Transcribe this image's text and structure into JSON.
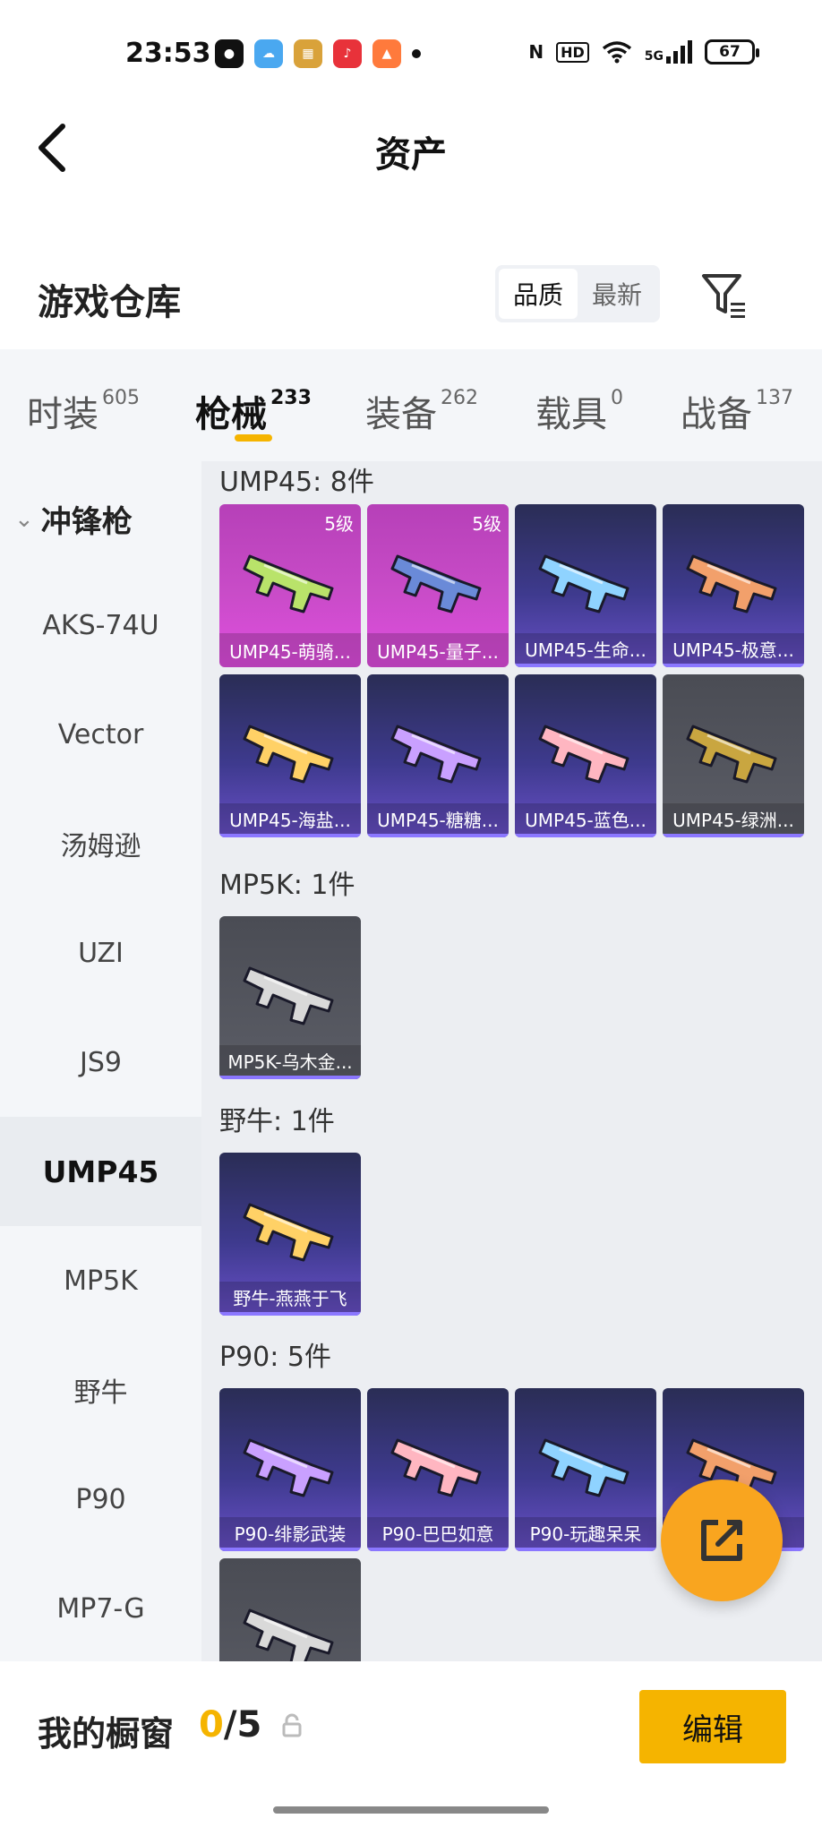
{
  "status": {
    "time": "23:53",
    "battery": "67",
    "network": "5G"
  },
  "header": {
    "title": "资产"
  },
  "warehouse": {
    "title": "游戏仓库",
    "sort_options": [
      "品质",
      "最新"
    ]
  },
  "tabs": [
    {
      "label": "时装",
      "count": "605"
    },
    {
      "label": "枪械",
      "count": "233"
    },
    {
      "label": "装备",
      "count": "262"
    },
    {
      "label": "载具",
      "count": "0"
    },
    {
      "label": "战备",
      "count": "137"
    }
  ],
  "sidebar": {
    "category": "冲锋枪",
    "items": [
      "AKS-74U",
      "Vector",
      "汤姆逊",
      "UZI",
      "JS9",
      "UMP45",
      "MP5K",
      "野牛",
      "P90",
      "MP7-G"
    ]
  },
  "sections": [
    {
      "title": "UMP45: 8件",
      "items": [
        {
          "label": "UMP45-萌骑...",
          "level": "5级",
          "style": "pink"
        },
        {
          "label": "UMP45-量子...",
          "level": "5级",
          "style": "pink"
        },
        {
          "label": "UMP45-生命...",
          "level": "",
          "style": "purple"
        },
        {
          "label": "UMP45-极意...",
          "level": "",
          "style": "purple"
        },
        {
          "label": "UMP45-海盐...",
          "level": "",
          "style": "purple"
        },
        {
          "label": "UMP45-糖糖...",
          "level": "",
          "style": "purple"
        },
        {
          "label": "UMP45-蓝色...",
          "level": "",
          "style": "purple"
        },
        {
          "label": "UMP45-绿洲...",
          "level": "",
          "style": "gray"
        }
      ]
    },
    {
      "title": "MP5K: 1件",
      "items": [
        {
          "label": "MP5K-乌木金...",
          "level": "",
          "style": "gray"
        }
      ]
    },
    {
      "title": "野牛: 1件",
      "items": [
        {
          "label": "野牛-燕燕于飞",
          "level": "",
          "style": "purple"
        }
      ]
    },
    {
      "title": "P90: 5件",
      "items": [
        {
          "label": "P90-绯影武装",
          "level": "",
          "style": "purple"
        },
        {
          "label": "P90-巴巴如意",
          "level": "",
          "style": "purple"
        },
        {
          "label": "P90-玩趣呆呆",
          "level": "",
          "style": "purple"
        },
        {
          "label": "影",
          "level": "",
          "style": "purple"
        },
        {
          "label": "",
          "level": "",
          "style": "gray"
        }
      ]
    }
  ],
  "bottom": {
    "showcase_label": "我的橱窗",
    "showcase_current": "0",
    "showcase_total": "/5",
    "edit_label": "编辑"
  },
  "colors": {
    "accent": "#f5b400",
    "fab": "#f9a51f",
    "card_purple": "#3e3a8e",
    "card_pink": "#c94cc8",
    "card_gray": "#55575f"
  }
}
